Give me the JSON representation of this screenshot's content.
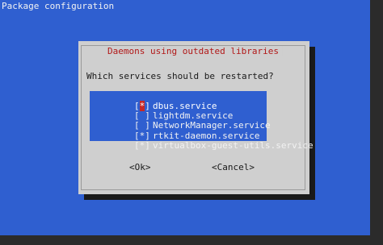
{
  "window": {
    "title": "Package configuration"
  },
  "dialog": {
    "title": "Daemons using outdated libraries",
    "question": "Which services should be restarted?",
    "items": [
      {
        "checked": true,
        "mark": "*",
        "label": "dbus.service",
        "focused": true
      },
      {
        "checked": false,
        "mark": " ",
        "label": "lightdm.service"
      },
      {
        "checked": false,
        "mark": " ",
        "label": "NetworkManager.service"
      },
      {
        "checked": true,
        "mark": "*",
        "label": "rtkit-daemon.service"
      },
      {
        "checked": true,
        "mark": "*",
        "label": "virtualbox-guest-utils.service"
      }
    ],
    "ok_label": "<Ok>",
    "cancel_label": "<Cancel>"
  },
  "colors": {
    "terminal_bg": "#2f5fd0",
    "dialog_bg": "#cfcfcf",
    "dialog_title": "#b21818",
    "focus_mark_bg": "#c62828"
  }
}
